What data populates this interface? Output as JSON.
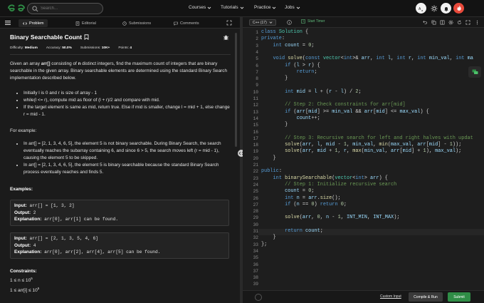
{
  "nav": {
    "search_placeholder": "Search...",
    "menus": [
      "Courses",
      "Tutorials",
      "Practice",
      "Jobs"
    ],
    "avatar_letter": "₹"
  },
  "tabs": [
    "Problem",
    "Editorial",
    "Submissions",
    "Comments"
  ],
  "problem": {
    "title": "Binary Searchable Count",
    "difficulty_label": "Difficulty:",
    "difficulty": "Medium",
    "accuracy_label": "Accuracy:",
    "accuracy": "50.0%",
    "submissions_label": "Submissions:",
    "submissions": "10K+",
    "points_label": "Points:",
    "points": "4",
    "intro_1": "Given an array ",
    "intro_arr": "arr[]",
    "intro_2": " consisting of ",
    "intro_n": "n",
    "intro_3": " distinct integers, find the maximum count of integers that are binary searchable in the given array. Binary searchable elements are determined using the standard Binary Search implementation described below.",
    "steps": [
      "Initially l is 0 and r is size of array - 1",
      "while(l <= r), compute mid as floor of (l + r)/2 and compare with mid.",
      "If the target element is same as mid, return true. Else if mid is smaller, change l = mid + 1, else change r = mid - 1."
    ],
    "for_example": "For example:",
    "examples_text": [
      "In arr[] = [2, 1, 3, 4, 6, 5], the element 5 is not binary searchable. During Binary Search, the search eventually reaches the subarray containing 6, and since 6 > 5, the search moves left (r = mid - 1), causing the element 5 to be skipped.",
      "In arr[] = [2, 1, 3, 4, 6, 5], the element 5 is binary searchable because the standard Binary Search process eventually reaches and finds 5."
    ],
    "examples_heading": "Examples:",
    "input_label": "Input:",
    "output_label": "Output:",
    "explanation_label": "Explanation:",
    "example1": {
      "input": " arr[] = [1, 3, 2]",
      "output": " 2",
      "explanation": " arr[0], arr[1] can be found."
    },
    "example2": {
      "input": " arr[] = [2, 1, 3, 5, 4, 6]",
      "output": " 4",
      "explanation": " arr[0], arr[2], arr[4], arr[5] can be found."
    },
    "constraints_heading": "Constraints:",
    "constraint1": "1 ≤ n ≤ 10",
    "constraint1_exp": "5",
    "constraint2": "1 ≤ arr[i] ≤ 10",
    "constraint2_exp": "5"
  },
  "editor": {
    "language": "C++ (17)",
    "start_timer": "Start Timer",
    "line_numbers": [
      "1",
      "2",
      "3",
      "4",
      "5",
      "6",
      "7",
      "8",
      "9",
      "10",
      "11",
      "12",
      "13",
      "14",
      "15",
      "16",
      "17",
      "18",
      "19",
      "20",
      "21",
      "22",
      "23",
      "24",
      "25",
      "26",
      "27",
      "28",
      "29",
      "30",
      "31",
      "32",
      "33",
      "34",
      "35",
      "36",
      "37",
      "38",
      "39"
    ],
    "custom_input": "Custom Input",
    "compile_run": "Compile & Run",
    "submit": "Submit"
  },
  "colors": {
    "accent": "#2f8d46",
    "bg": "#1b1b1b"
  }
}
